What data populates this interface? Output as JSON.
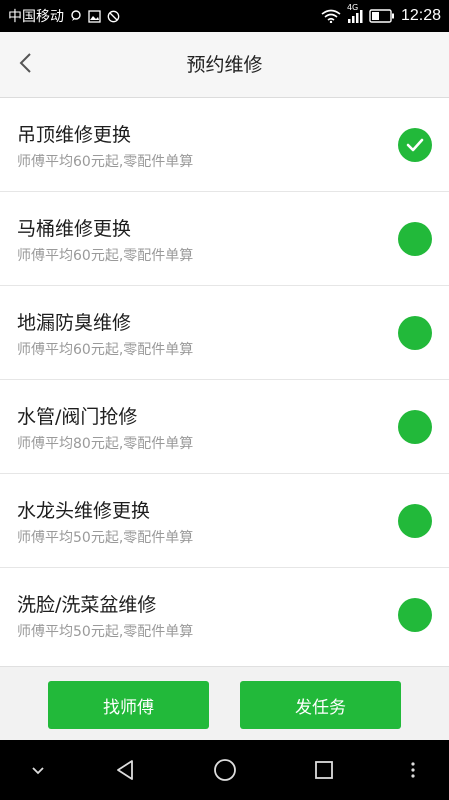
{
  "status_bar": {
    "carrier": "中国移动",
    "time": "12:28",
    "network": "4G",
    "icons": [
      "message-icon",
      "image-icon",
      "blocked-icon",
      "wifi-icon",
      "signal-icon",
      "battery-icon"
    ]
  },
  "header": {
    "title": "预约维修",
    "back_icon": "chevron-left-icon"
  },
  "services": [
    {
      "title": "吊顶维修更换",
      "subtitle": "师傅平均60元起,零配件单算",
      "selected": true
    },
    {
      "title": "马桶维修更换",
      "subtitle": "师傅平均60元起,零配件单算",
      "selected": false
    },
    {
      "title": "地漏防臭维修",
      "subtitle": "师傅平均60元起,零配件单算",
      "selected": false
    },
    {
      "title": "水管/阀门抢修",
      "subtitle": "师傅平均80元起,零配件单算",
      "selected": false
    },
    {
      "title": "水龙头维修更换",
      "subtitle": "师傅平均50元起,零配件单算",
      "selected": false
    },
    {
      "title": "洗脸/洗菜盆维修",
      "subtitle": "师傅平均50元起,零配件单算",
      "selected": false
    }
  ],
  "actions": {
    "find_master": "找师傅",
    "post_task": "发任务"
  },
  "nav_bar": {
    "icons": [
      "chevron-down-icon",
      "back-triangle-icon",
      "home-circle-icon",
      "recents-square-icon",
      "more-dots-icon"
    ]
  },
  "colors": {
    "accent": "#22b93a",
    "background": "#f2f2f2",
    "status_bar": "#000000"
  }
}
